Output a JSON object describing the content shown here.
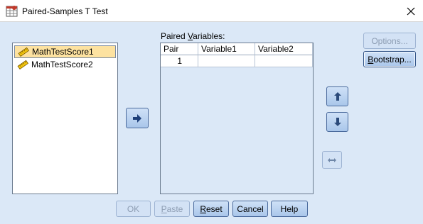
{
  "window": {
    "title": "Paired-Samples T Test"
  },
  "source_variables": [
    {
      "label": "MathTestScore1",
      "selected": true
    },
    {
      "label": "MathTestScore2",
      "selected": false
    }
  ],
  "paired_variables": {
    "label_before": "Paired ",
    "label_mnemonic": "V",
    "label_after": "ariables:",
    "columns": [
      "Pair",
      "Variable1",
      "Variable2"
    ],
    "rows": [
      {
        "pair": "1",
        "variable1": "",
        "variable2": ""
      }
    ]
  },
  "side_buttons": {
    "options": "Options...",
    "bootstrap_mnemonic": "B",
    "bootstrap_rest": "ootstrap..."
  },
  "bottom_buttons": {
    "ok": "OK",
    "paste_mnemonic": "P",
    "paste_rest": "aste",
    "reset_mnemonic": "R",
    "reset_rest": "eset",
    "cancel": "Cancel",
    "help": "Help"
  },
  "colors": {
    "dialog_background": "#dbe8f7",
    "selected_item": "#fde2a0",
    "button_border": "#4a6a9c"
  },
  "icons": {
    "app": "spss-dialog-icon",
    "move": "arrow-right-icon",
    "up": "arrow-up-icon",
    "down": "arrow-down-icon",
    "swap": "swap-horizontal-icon",
    "variable": "scale-ruler-icon"
  }
}
